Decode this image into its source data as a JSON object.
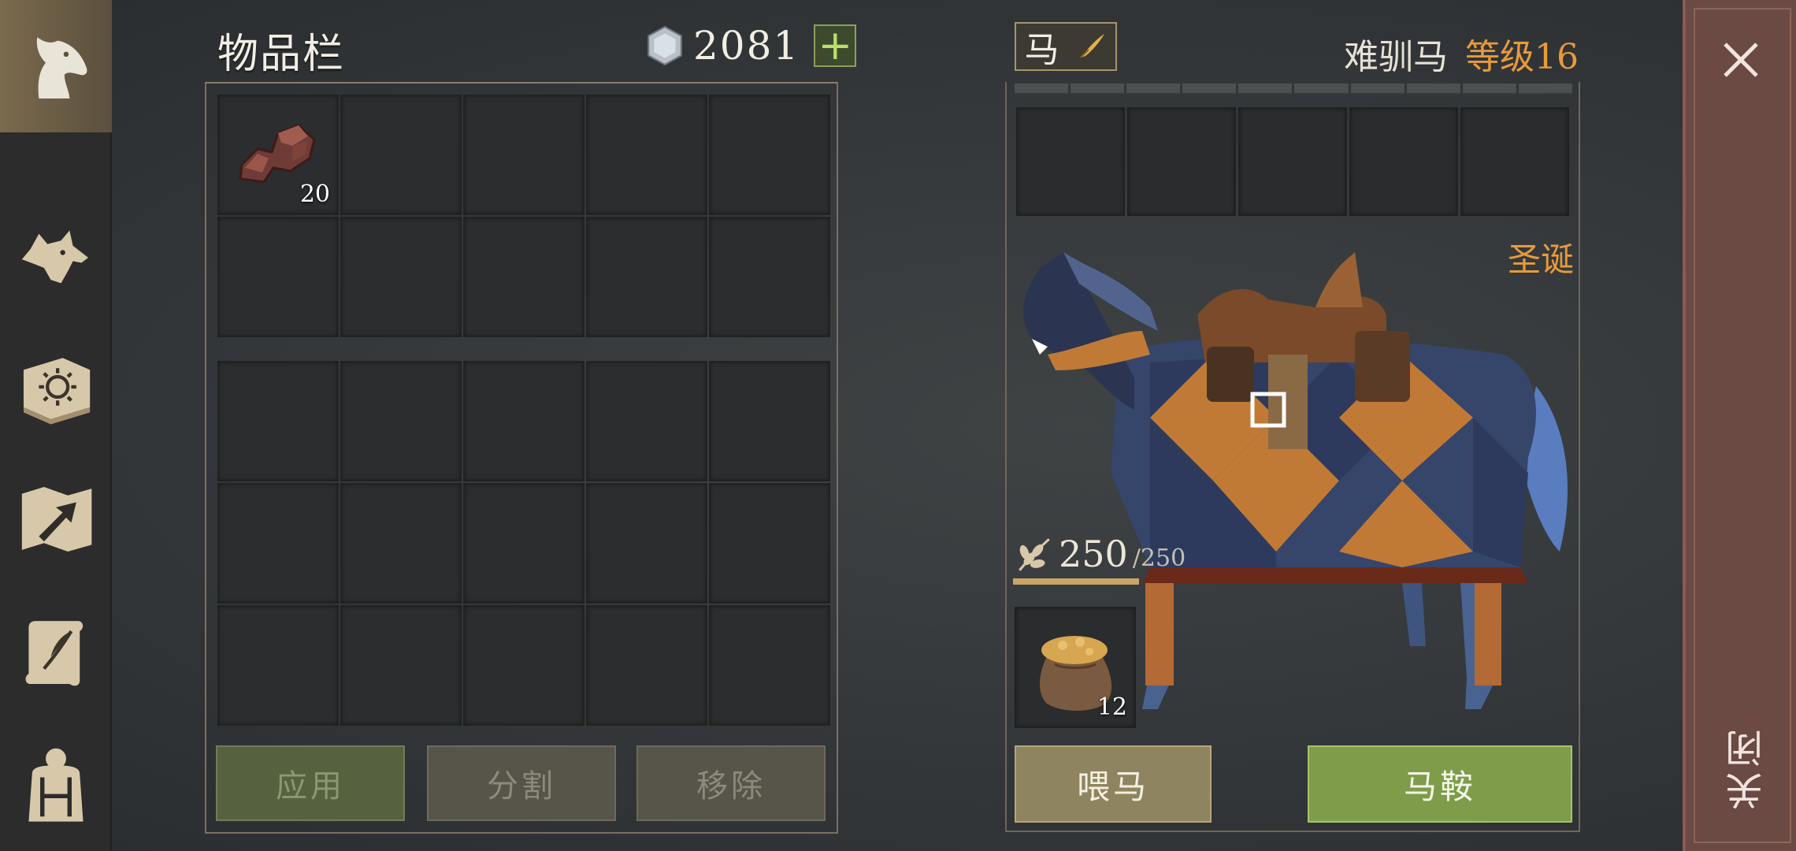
{
  "sidebar": {
    "items": [
      {
        "icon": "horse-head-icon",
        "active": true
      },
      {
        "icon": "wolf-head-icon",
        "active": false
      },
      {
        "icon": "sun-book-icon",
        "active": false
      },
      {
        "icon": "map-arrow-icon",
        "active": false
      },
      {
        "icon": "scroll-quill-icon",
        "active": false
      },
      {
        "icon": "character-backpack-icon",
        "active": false
      }
    ]
  },
  "inventory": {
    "title": "物品栏",
    "currency_icon": "silver-coin-icon",
    "currency_amount": "2081",
    "add_currency_label": "+",
    "top_grid": [
      {
        "item": "copper-ore",
        "count": "20"
      },
      {},
      {},
      {},
      {},
      {},
      {},
      {},
      {},
      {}
    ],
    "bottom_grid_size": 15,
    "buttons": {
      "apply": "应用",
      "split": "分割",
      "remove": "移除"
    }
  },
  "horse": {
    "tab_label": "马",
    "horse_type": "难驯马",
    "level": "等级16",
    "skin_label": "圣诞",
    "equip_slots": 5,
    "food_current": "250",
    "food_max": "/250",
    "feed_item_count": "12",
    "buttons": {
      "feed": "喂马",
      "saddle": "马鞍"
    }
  },
  "close": {
    "label": "关闭"
  },
  "colors": {
    "orange_accent": "#e89a3a",
    "green_button": "#7e9c49",
    "close_panel": "#6b4a44"
  }
}
